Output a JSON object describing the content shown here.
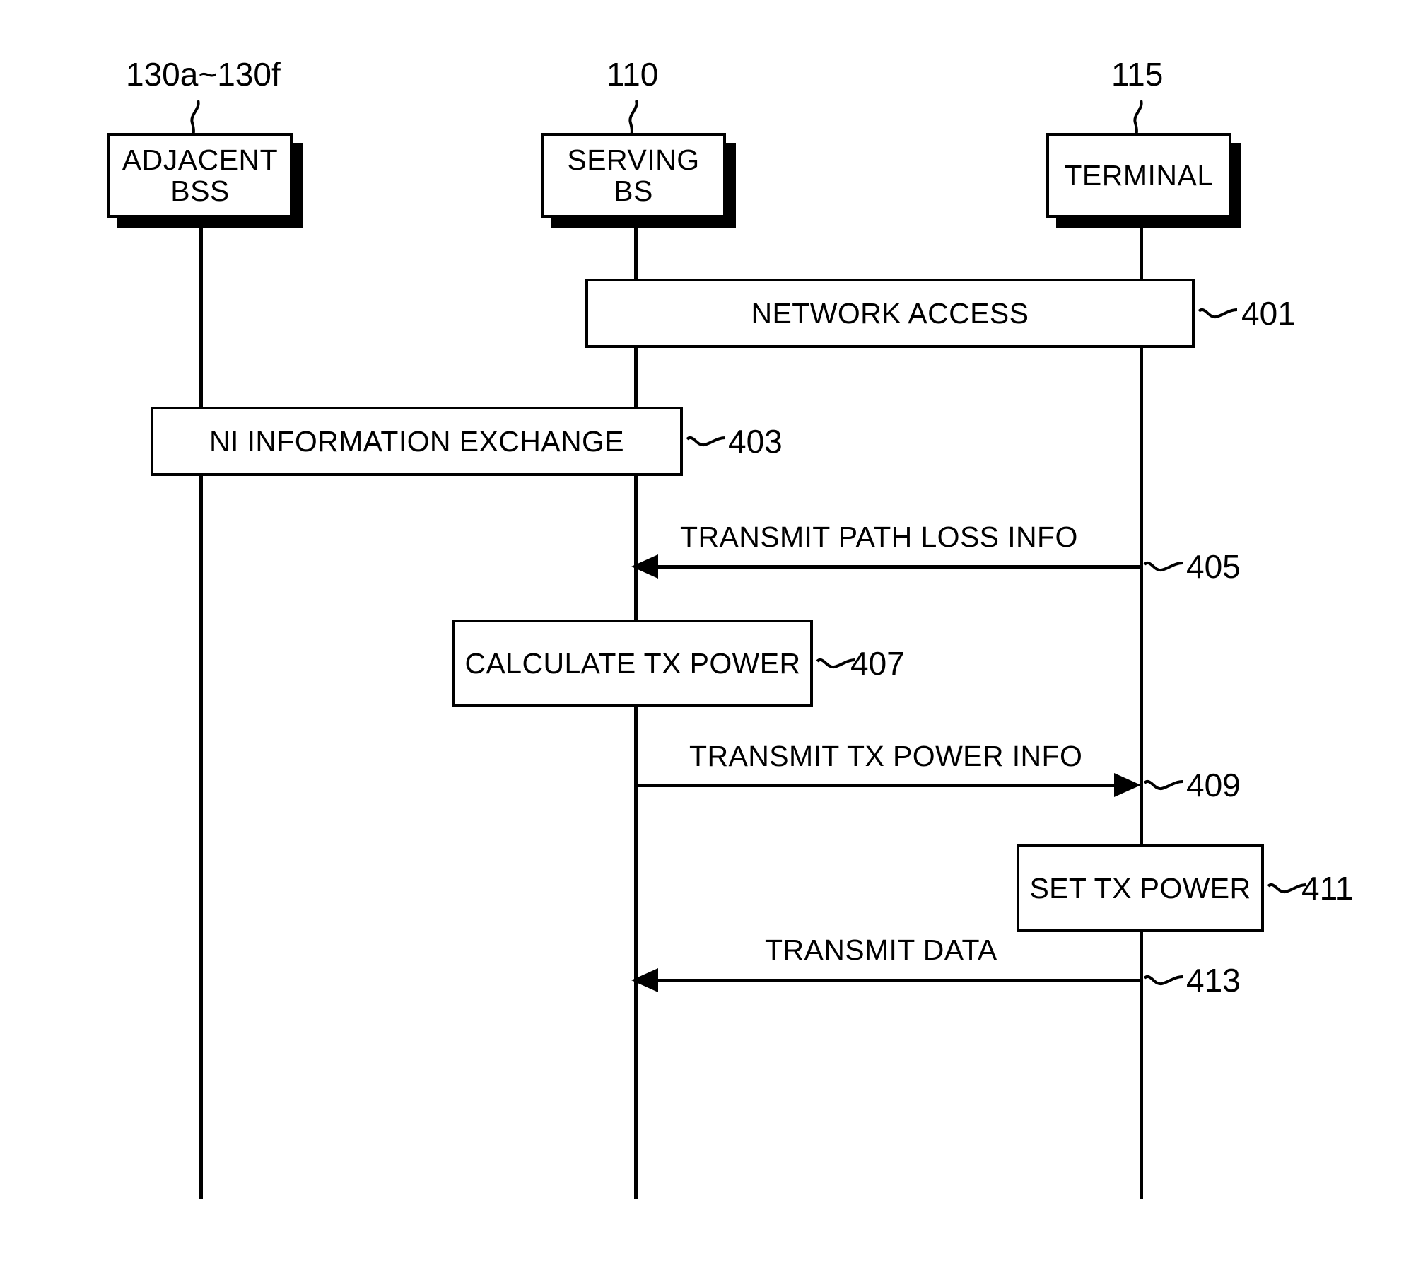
{
  "figure": {
    "type": "patent-sequence-diagram",
    "entities": [
      {
        "id": "adjacent-bss",
        "ref": "130a~130f",
        "label_line1": "ADJACENT",
        "label_line2": "BSS"
      },
      {
        "id": "serving-bs",
        "ref": "110",
        "label_line1": "SERVING",
        "label_line2": "BS"
      },
      {
        "id": "terminal",
        "ref": "115",
        "label_line1": "TERMINAL",
        "label_line2": ""
      }
    ],
    "steps": [
      {
        "num": "401",
        "label": "NETWORK ACCESS",
        "kind": "span-box",
        "from": "serving-bs",
        "to": "terminal"
      },
      {
        "num": "403",
        "label": "NI INFORMATION EXCHANGE",
        "kind": "span-box",
        "from": "adjacent-bss",
        "to": "serving-bs"
      },
      {
        "num": "405",
        "label": "TRANSMIT PATH LOSS  INFO",
        "kind": "message",
        "from": "terminal",
        "to": "serving-bs",
        "direction": "left"
      },
      {
        "num": "407",
        "label": "CALCULATE TX POWER",
        "kind": "self-box",
        "on": "serving-bs"
      },
      {
        "num": "409",
        "label": "TRANSMIT TX POWER INFO",
        "kind": "message",
        "from": "serving-bs",
        "to": "terminal",
        "direction": "right"
      },
      {
        "num": "411",
        "label": "SET TX POWER",
        "kind": "self-box",
        "on": "terminal"
      },
      {
        "num": "413",
        "label": "TRANSMIT DATA",
        "kind": "message",
        "from": "terminal",
        "to": "serving-bs",
        "direction": "left"
      }
    ],
    "colors": {
      "ink": "#000000",
      "paper": "#ffffff"
    }
  }
}
